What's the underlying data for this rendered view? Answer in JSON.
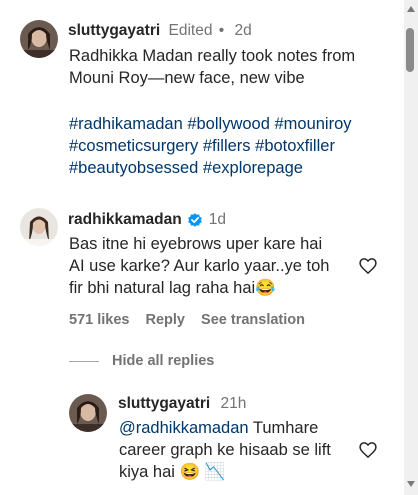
{
  "comment1": {
    "username": "sluttygayatri",
    "edited": "Edited",
    "sep": "•",
    "time": "2d",
    "line1": "Radhikka Madan really took notes from",
    "line2": "Mouni Roy—new face, new vibe",
    "hashtags_line1": "#radhikamadan #bollywood #mouniroy",
    "hashtags_line2": "#cosmeticsurgery #fillers #botoxfiller",
    "hashtags_line3": "#beautyobsessed #explorepage"
  },
  "comment2": {
    "username": "radhikkamadan",
    "time": "1d",
    "line1": "Bas itne hi eyebrows uper kare hai",
    "line2": "AI use karke? Aur karlo yaar..ye toh",
    "line3": "fir bhi natural lag raha hai😂",
    "likes": "571 likes",
    "reply": "Reply",
    "see_translation": "See translation",
    "hide_replies": "Hide all replies"
  },
  "reply1": {
    "username": "sluttygayatri",
    "time": "21h",
    "mention": "@radhikkamadan",
    "line1_rest": " Tumhare",
    "line2": "career graph ke hisaab se lift",
    "line3": "kiya hai 😆 📉"
  },
  "icons": {
    "verified": "verified-badge-icon",
    "heart": "heart-outline-icon"
  },
  "colors": {
    "verified": "#0095f6",
    "hashtag": "#00376b",
    "muted": "#737373"
  }
}
